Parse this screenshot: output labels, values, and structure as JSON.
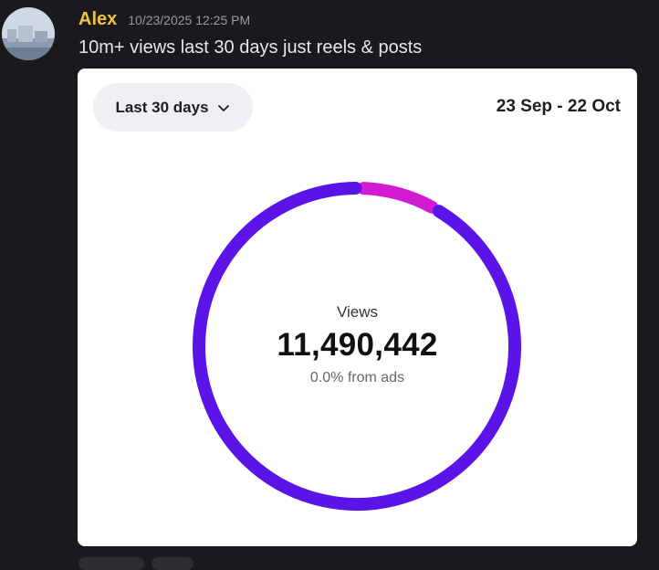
{
  "message": {
    "username": "Alex",
    "timestamp": "10/23/2025 12:25 PM",
    "text": "10m+ views last 30 days just reels & posts"
  },
  "card": {
    "range_label": "Last 30 days",
    "date_range": "23 Sep - 22 Oct",
    "metric_label": "Views",
    "metric_value": "11,490,442",
    "ads_text": "0.0% from ads"
  },
  "icons": {
    "dropdown": "chevron-down-icon",
    "avatar": "avatar-photo"
  },
  "colors": {
    "username": "#f0c33c",
    "ring_primary": "#5b14e8",
    "ring_accent": "#d21ad2",
    "background": "#1a1a1e"
  },
  "chart_data": {
    "type": "pie",
    "title": "",
    "segments": [
      {
        "name": "",
        "value": 92,
        "color": "#5b14e8"
      },
      {
        "name": "",
        "value": 8,
        "color": "#d21ad2"
      }
    ]
  }
}
